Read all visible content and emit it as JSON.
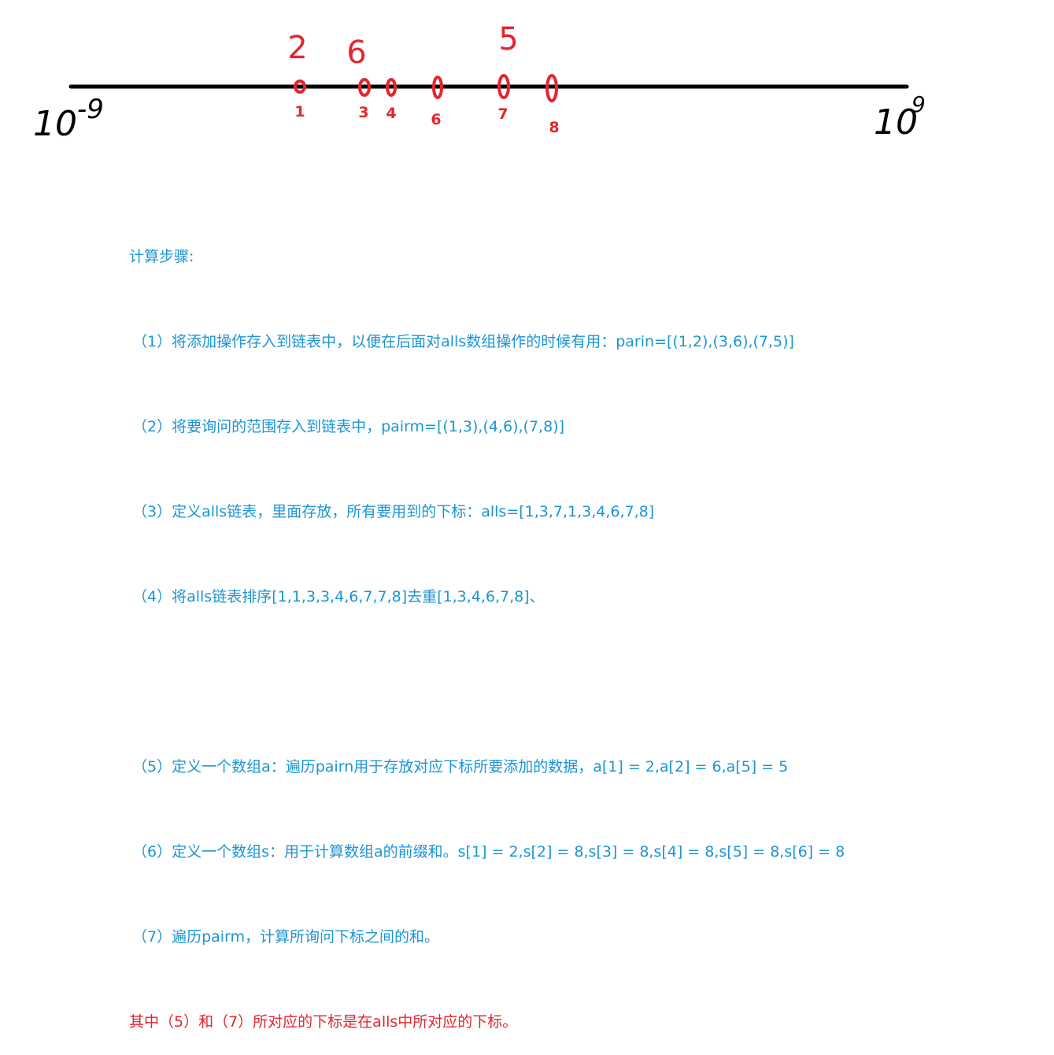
{
  "axis": {
    "left_label": "10",
    "left_exponent": "-9",
    "right_label": "10",
    "right_exponent": "9"
  },
  "points": [
    {
      "index": "1",
      "value": "2"
    },
    {
      "index": "3",
      "value": "6"
    },
    {
      "index": "4",
      "value": ""
    },
    {
      "index": "6",
      "value": ""
    },
    {
      "index": "7",
      "value": "5"
    },
    {
      "index": "8",
      "value": ""
    }
  ],
  "colors": {
    "axis": "#000000",
    "points": "#e3262d",
    "steps_text": "#1b95d3",
    "note_text": "#e3262d"
  },
  "steps": {
    "title": "计算步骤:",
    "s1": "（1）将添加操作存入到链表中，以便在后面对alls数组操作的时候有用：parin=[(1,2),(3,6),(7,5)]",
    "s2": "（2）将要询问的范围存入到链表中，pairm=[(1,3),(4,6),(7,8)]",
    "s3": "（3）定义alls链表，里面存放，所有要用到的下标：alls=[1,3,7,1,3,4,6,7,8]",
    "s4": "（4）将alls链表排序[1,1,3,3,4,6,7,7,8]去重[1,3,4,6,7,8]、",
    "s5": "（5）定义一个数组a：遍历pairn用于存放对应下标所要添加的数据，a[1] = 2,a[2] = 6,a[5] = 5",
    "s6": "（6）定义一个数组s：用于计算数组a的前缀和。s[1] = 2,s[2] = 8,s[3] = 8,s[4] = 8,s[5] = 8,s[6] = 8",
    "s7": "（7）遍历pairm，计算所询问下标之间的和。",
    "note": "其中（5）和（7）所对应的下标是在alls中所对应的下标。"
  }
}
